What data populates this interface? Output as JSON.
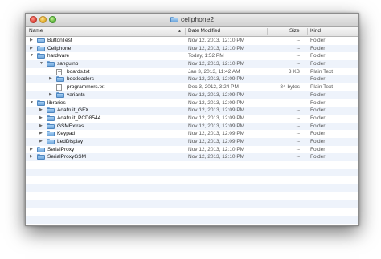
{
  "window": {
    "title": "cellphone2"
  },
  "columns": {
    "name": "Name",
    "date": "Date Modified",
    "size": "Size",
    "kind": "Kind"
  },
  "rows": [
    {
      "name": "ButtonTest",
      "date": "Nov 12, 2013, 12:10 PM",
      "size": "--",
      "kind": "Folder",
      "type": "folder",
      "level": 0,
      "expanded": false
    },
    {
      "name": "Cellphone",
      "date": "Nov 12, 2013, 12:10 PM",
      "size": "--",
      "kind": "Folder",
      "type": "folder",
      "level": 0,
      "expanded": false
    },
    {
      "name": "hardware",
      "date": "Today, 1:52 PM",
      "size": "--",
      "kind": "Folder",
      "type": "folder",
      "level": 0,
      "expanded": true
    },
    {
      "name": "sanguino",
      "date": "Nov 12, 2013, 12:10 PM",
      "size": "--",
      "kind": "Folder",
      "type": "folder",
      "level": 1,
      "expanded": true
    },
    {
      "name": "boards.txt",
      "date": "Jan 3, 2013, 11:42 AM",
      "size": "3 KB",
      "kind": "Plain Text",
      "type": "file",
      "level": 2
    },
    {
      "name": "bootloaders",
      "date": "Nov 12, 2013, 12:09 PM",
      "size": "--",
      "kind": "Folder",
      "type": "folder",
      "level": 2,
      "expanded": false
    },
    {
      "name": "programmers.txt",
      "date": "Dec 3, 2012, 3:24 PM",
      "size": "84 bytes",
      "kind": "Plain Text",
      "type": "file",
      "level": 2
    },
    {
      "name": "variants",
      "date": "Nov 12, 2013, 12:09 PM",
      "size": "--",
      "kind": "Folder",
      "type": "folder",
      "level": 2,
      "expanded": false
    },
    {
      "name": "libraries",
      "date": "Nov 12, 2013, 12:09 PM",
      "size": "--",
      "kind": "Folder",
      "type": "folder",
      "level": 0,
      "expanded": true
    },
    {
      "name": "Adafruit_GFX",
      "date": "Nov 12, 2013, 12:09 PM",
      "size": "--",
      "kind": "Folder",
      "type": "folder",
      "level": 1,
      "expanded": false
    },
    {
      "name": "Adafruit_PCD8544",
      "date": "Nov 12, 2013, 12:09 PM",
      "size": "--",
      "kind": "Folder",
      "type": "folder",
      "level": 1,
      "expanded": false
    },
    {
      "name": "GSMExtras",
      "date": "Nov 12, 2013, 12:09 PM",
      "size": "--",
      "kind": "Folder",
      "type": "folder",
      "level": 1,
      "expanded": false
    },
    {
      "name": "Keypad",
      "date": "Nov 12, 2013, 12:09 PM",
      "size": "--",
      "kind": "Folder",
      "type": "folder",
      "level": 1,
      "expanded": false
    },
    {
      "name": "LedDisplay",
      "date": "Nov 12, 2013, 12:09 PM",
      "size": "--",
      "kind": "Folder",
      "type": "folder",
      "level": 1,
      "expanded": false
    },
    {
      "name": "SerialProxy",
      "date": "Nov 12, 2013, 12:10 PM",
      "size": "--",
      "kind": "Folder",
      "type": "folder",
      "level": 0,
      "expanded": false
    },
    {
      "name": "SerialProxyGSM",
      "date": "Nov 12, 2013, 12:10 PM",
      "size": "--",
      "kind": "Folder",
      "type": "folder",
      "level": 0,
      "expanded": false
    }
  ],
  "empty_rows": 8
}
